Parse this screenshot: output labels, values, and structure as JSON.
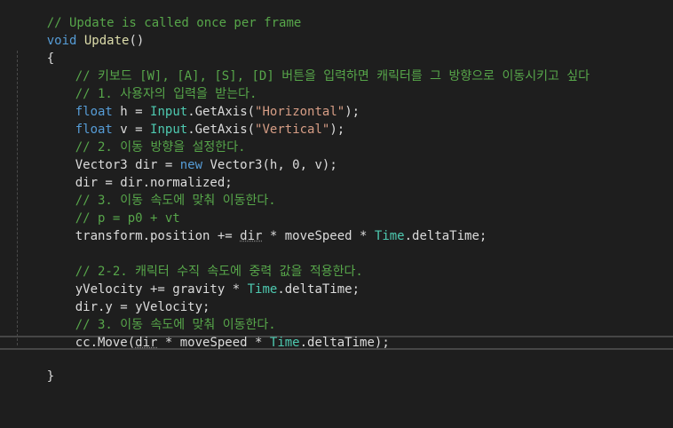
{
  "code": {
    "l0": "// Update is called once per frame",
    "l1_kw": "void",
    "l1_fn": "Update",
    "l1_tail": "()",
    "l2": "{",
    "l3": "// 키보드 [W], [A], [S], [D] 버튼을 입력하면 캐릭터를 그 방향으로 이동시키고 싶다",
    "l4": "// 1. 사용자의 입력을 받는다.",
    "l5_kw": "float",
    "l5_a": " h = ",
    "l5_type": "Input",
    "l5_b": ".GetAxis(",
    "l5_str": "\"Horizontal\"",
    "l5_c": ");",
    "l6_kw": "float",
    "l6_a": " v = ",
    "l6_type": "Input",
    "l6_b": ".GetAxis(",
    "l6_str": "\"Vertical\"",
    "l6_c": ");",
    "l7": "// 2. 이동 방향을 설정한다.",
    "l8_a": "Vector3 dir = ",
    "l8_kw": "new",
    "l8_b": " Vector3(h, 0, v);",
    "l9": "dir = dir.normalized;",
    "l10": "// 3. 이동 속도에 맞춰 이동한다.",
    "l11": "// p = p0 + vt",
    "l12_a": "transform.position += ",
    "l12_sq": "dir",
    "l12_b": " * moveSpeed * ",
    "l12_type": "Time",
    "l12_c": ".deltaTime;",
    "l14": "// 2-2. 캐릭터 수직 속도에 중력 값을 적용한다.",
    "l15_a": "yVelocity += gravity * ",
    "l15_type": "Time",
    "l15_b": ".deltaTime;",
    "l16": "dir.y = yVelocity;",
    "l17": "// 3. 이동 속도에 맞춰 이동한다.",
    "l18_a": "cc.Move(",
    "l18_sq": "dir",
    "l18_b": " * moveSpeed * ",
    "l18_type": "Time",
    "l18_c": ".deltaTime);",
    "l20": "}"
  }
}
